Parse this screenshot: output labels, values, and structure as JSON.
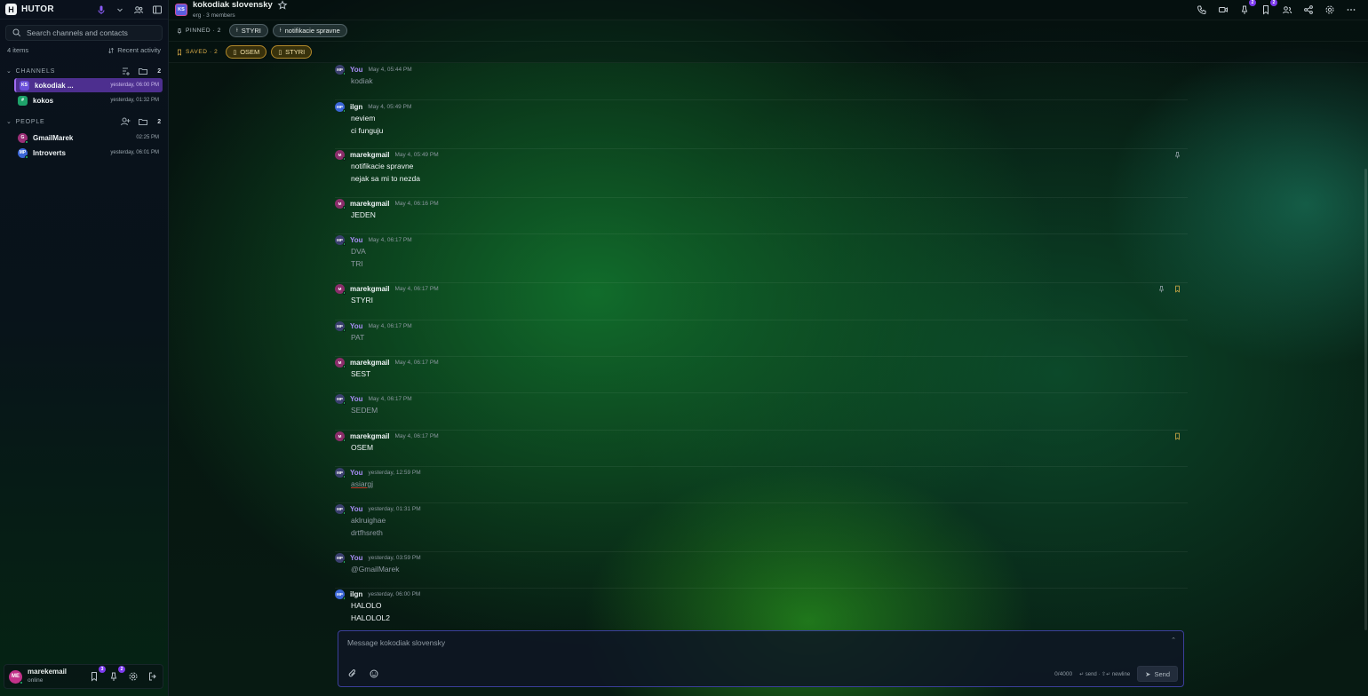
{
  "app": {
    "brand": "HUTOR",
    "logo_letter": "H"
  },
  "sidebar": {
    "search_placeholder": "Search channels and contacts",
    "items_count": "4 items",
    "recent_label": "Recent activity",
    "channels": {
      "title": "CHANNELS",
      "count": "2",
      "items": [
        {
          "initials": "KS",
          "name": "kokodiak ...",
          "time": "yesterday, 06:00 PM",
          "color": "#6a4fd9"
        },
        {
          "initials": "#",
          "name": "kokos",
          "time": "yesterday, 01:32 PM",
          "color": "#1ea26a"
        }
      ]
    },
    "people": {
      "title": "PEOPLE",
      "count": "2",
      "items": [
        {
          "initials": "G",
          "name": "GmailMarek",
          "time": "02:25 PM",
          "color": "#9b2f77"
        },
        {
          "initials": "MP",
          "name": "Introverts",
          "time": "yesterday, 06:01 PM",
          "color": "#3b66d6"
        }
      ]
    },
    "user": {
      "initials": "ME",
      "name": "marekemail",
      "status": "online",
      "saved_badge": "3",
      "pinned_badge": "2"
    }
  },
  "header": {
    "channel_initials": "KS",
    "channel_name": "kokodiak slovensky",
    "channel_sub": "erg · 3 members",
    "pinned_badge": "2",
    "saved_badge": "2"
  },
  "pinned": {
    "label": "PINNED · 2",
    "chips": [
      "STYRI",
      "notifikacie spravne"
    ]
  },
  "saved": {
    "label": "SAVED · 2",
    "chips": [
      "OSEM",
      "STYRI"
    ]
  },
  "messages": [
    {
      "author": "You",
      "avatar": "MP",
      "kind": "you",
      "time": "May 4, 05:44 PM",
      "lines": [
        "kodiak"
      ],
      "flags": []
    },
    {
      "author": "ilgn",
      "avatar": "MP",
      "kind": "ilgn",
      "time": "May 4, 05:49 PM",
      "lines": [
        "neviem",
        "ci funguju"
      ],
      "flags": []
    },
    {
      "author": "marekgmail",
      "avatar": "M",
      "kind": "marek",
      "time": "May 4, 05:49 PM",
      "lines": [
        "notifikacie spravne",
        "nejak sa mi to nezda"
      ],
      "flags": [
        "pin"
      ]
    },
    {
      "author": "marekgmail",
      "avatar": "M",
      "kind": "marek",
      "time": "May 4, 06:16 PM",
      "lines": [
        "JEDEN"
      ],
      "flags": []
    },
    {
      "author": "You",
      "avatar": "MP",
      "kind": "you",
      "time": "May 4, 06:17 PM",
      "lines": [
        "DVA",
        "TRI"
      ],
      "flags": []
    },
    {
      "author": "marekgmail",
      "avatar": "M",
      "kind": "marek",
      "time": "May 4, 06:17 PM",
      "lines": [
        "STYRI"
      ],
      "flags": [
        "pin",
        "save"
      ]
    },
    {
      "author": "You",
      "avatar": "MP",
      "kind": "you",
      "time": "May 4, 06:17 PM",
      "lines": [
        "PAT"
      ],
      "flags": []
    },
    {
      "author": "marekgmail",
      "avatar": "M",
      "kind": "marek",
      "time": "May 4, 06:17 PM",
      "lines": [
        "SEST"
      ],
      "flags": []
    },
    {
      "author": "You",
      "avatar": "MP",
      "kind": "you",
      "time": "May 4, 06:17 PM",
      "lines": [
        "SEDEM"
      ],
      "flags": []
    },
    {
      "author": "marekgmail",
      "avatar": "M",
      "kind": "marek",
      "time": "May 4, 06:17 PM",
      "lines": [
        "OSEM"
      ],
      "flags": [
        "save"
      ]
    },
    {
      "author": "You",
      "avatar": "MP",
      "kind": "you",
      "time": "yesterday, 12:59 PM",
      "lines": [
        "asiargj"
      ],
      "flags": [],
      "underline": true
    },
    {
      "author": "You",
      "avatar": "MP",
      "kind": "you",
      "time": "yesterday, 01:31 PM",
      "lines": [
        "aklruighae",
        "drtfhsreth"
      ],
      "flags": []
    },
    {
      "author": "You",
      "avatar": "MP",
      "kind": "you",
      "time": "yesterday, 03:59 PM",
      "lines": [
        "@GmailMarek"
      ],
      "flags": []
    },
    {
      "author": "ilgn",
      "avatar": "MP",
      "kind": "ilgn",
      "time": "yesterday, 06:00 PM",
      "lines": [
        "HALOLO",
        "HALOLOL2"
      ],
      "flags": []
    }
  ],
  "composer": {
    "placeholder": "Message kokodiak slovensky",
    "char_count": "0/4000",
    "hint": "↵ send · ⇧↵ newline",
    "send_label": "Send"
  },
  "colors": {
    "accent": "#7c3aed",
    "save": "#e2b34a",
    "online": "#27c368"
  }
}
